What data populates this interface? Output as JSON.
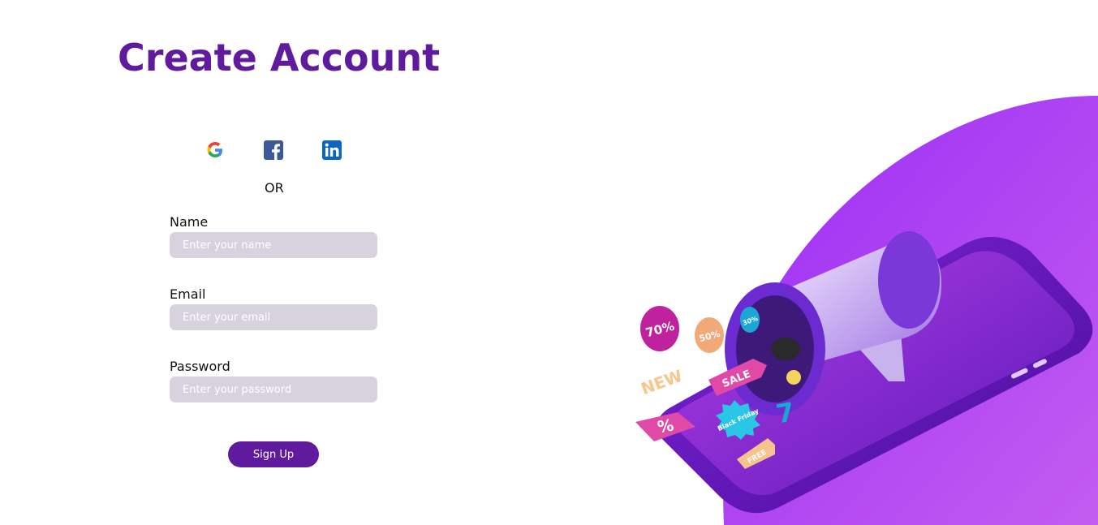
{
  "page": {
    "title": "Create Account"
  },
  "social": {
    "icons": [
      "google-icon",
      "facebook-icon",
      "linkedin-icon"
    ],
    "separator": "OR"
  },
  "form": {
    "name": {
      "label": "Name",
      "placeholder": "Enter your name",
      "value": ""
    },
    "email": {
      "label": "Email",
      "placeholder": "Enter your email",
      "value": ""
    },
    "password": {
      "label": "Password",
      "placeholder": "Enter your password",
      "value": ""
    },
    "submit_label": "Sign Up"
  },
  "illustration": {
    "tags": [
      "70%",
      "50%",
      "30%",
      "NEW",
      "SALE",
      "Black Friday",
      "%",
      "FREE",
      "7"
    ]
  },
  "colors": {
    "brand": "#5f1a9e",
    "input_bg": "#d6d2de",
    "accent_gradient_start": "#9b2cf5",
    "accent_gradient_end": "#c35cf0"
  }
}
